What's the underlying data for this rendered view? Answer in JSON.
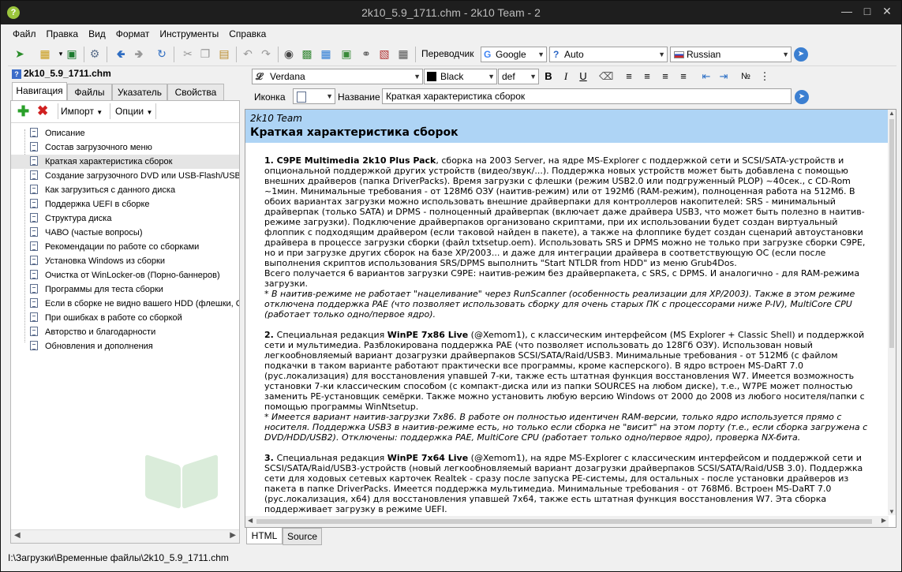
{
  "window": {
    "title": "2k10_5.9_1711.chm - 2k10 Team - 2",
    "app_icon": "?"
  },
  "menu": [
    "Файл",
    "Правка",
    "Вид",
    "Формат",
    "Инструменты",
    "Справка"
  ],
  "toolbar": {
    "translator_label": "Переводчик",
    "engine": "Google",
    "source_lang": "Auto",
    "target_lang": "Russian"
  },
  "left_panel": {
    "file_name": "2k10_5.9_1711.chm",
    "tabs": [
      "Навигация",
      "Файлы",
      "Указатель",
      "Свойства"
    ],
    "import_label": "Импорт",
    "options_label": "Опции",
    "tree": [
      "Описание",
      "Состав загрузочного меню",
      "Краткая характеристика сборок",
      "Создание загрузочного DVD или USB-Flash/USB+",
      "Как загрузиться с данного диска",
      "Поддержка UEFI в сборке",
      "Структура диска",
      "ЧАВО (частые вопросы)",
      "Рекомендации по работе со сборками",
      "Установка Windows из сборки",
      "Очистка от WinLocker-ов (Порно-баннеров)",
      "Программы для теста сборки",
      "Если в сборке не видно вашего HDD (флешки, CI",
      "При ошибках в работе со сборкой",
      "Авторство и благодарности",
      "Обновления и дополнения"
    ],
    "selected_index": 2
  },
  "status_path": "I:\\Загрузки\\Временные файлы\\2k10_5.9_1711.chm",
  "editor": {
    "font": "Verdana",
    "color": "Black",
    "size": "def",
    "icon_label": "Иконка",
    "name_label": "Название",
    "name_value": "Краткая характеристика сборок"
  },
  "document": {
    "team": "2k10 Team",
    "heading": "Краткая характеристика сборок",
    "p1_num": "1. ",
    "p1_title": "C9PE Multimedia 2k10 Plus Pack",
    "p1_text": ", сборка на 2003 Server, на ядре MS-Explorer с поддержкой сети и SCSI/SATA-устройств и опциональной поддержкой других устройств (видео/звук/...). Поддержка новых устройств может быть добавлена с помощью внешних драйверов (папка DriverPacks). Время загрузки с флешки (режим USB2.0 или подгруженный PLOP) ~40сек., с CD-Rom ~1мин. Минимальные требования - от 128Мб ОЗУ (наитив-режим) или от 192Мб (RAM-режим), полноценная работа на 512Мб. В обоих вариантах загрузки можно использовать внешние драйверпаки для контроллеров накопителей: SRS - минимальный драйверпак (только SATA) и DPMS - полноценный драйверпак (включает даже драйвера USB3, что может быть полезно в наитив-режиме загрузки). Подключение драйверпаков организовано скриптами, при их использовании будет создан виртуальный флоппик с подходящим драйвером (если таковой найден в пакете), а также на флоппике будет создан сценарий автоустановки драйвера в процессе загрузки сборки (файл txtsetup.oem). Использовать SRS и DPMS можно не только при загрузке сборки C9PE, но и при загрузке других сборок на базе XP/2003... и даже для интеграции драйвера в соответствующую ОС (если после выполнения скриптов использования SRS/DPMS выполнить \"Start NTLDR from HDD\" из меню Grub4Dos.",
    "p1_text2": "Всего получается 6 вариантов загрузки C9PE: наитив-режим без драйверпакета, с SRS, с DPMS. И аналогично - для RAM-режима загрузки.",
    "p1_note": "* В наитив-режиме не работает \"нацеливание\" через RunScanner (особенность реализации для XP/2003). Также в этом режиме отключена поддержка PAE (что позволяет использовать сборку для очень старых ПК с процессорами ниже P-IV), MultiCore CPU (работает только одно/первое ядро).",
    "p2_num": "2. ",
    "p2_pre": "Специальная редакция ",
    "p2_title": "WinPE 7x86 Live",
    "p2_text": " (@Xemom1), с классическим интерфейсом (MS Explorer + Classic Shell) и поддержкой сети и мультимедиа. Разблокирована поддержка PAE (что позволяет использовать до 128Гб ОЗУ). Использован новый легкообновляемый вариант дозагрузки драйверпаков SCSI/SATA/Raid/USB3. Минимальные требования - от 512Мб (с файлом подкачки в таком варианте работают практически все программы, кроме касперского). В ядро встроен MS-DaRT 7.0 (рус.локализация) для восстановления упавшей 7-ки, также есть штатная функция восстановления W7. Имеется возможность установки 7-ки классическим способом (с компакт-диска или из папки SOURCES на любом диске), т.е., W7PE может полностью заменить PE-установщик семёрки. Также можно установить любую версию Windows от 2000 до 2008 из любого носителя/папки с помощью программы WinNtsetup.",
    "p2_note": "* Имеется вариант наитив-загрузки 7x86. В работе он полностью идентичен RAM-версии, только ядро используется прямо с носителя. Поддержка USB3 в наитив-режиме есть, но только если сборка не \"висит\" на этом порту (т.е., если сборка загружена с DVD/HDD/USB2). Отключены: поддержка PAE, MultiCore CPU (работает только одно/первое ядро), проверка NX-бита.",
    "p3_num": "3. ",
    "p3_pre": "Специальная редакция ",
    "p3_title": "WinPE 7x64 Live",
    "p3_text": " (@Xemom1), на ядре MS-Explorer с классическим интерфейсом и поддержкой сети и SCSI/SATA/Raid/USB3-устройств (новый легкообновляемый вариант дозагрузки драйверпаков SCSI/SATA/Raid/USB 3.0). Поддержка сети для ходовых сетевых карточек Realtek - сразу после запуска PE-системы, для остальных - после установки драйверов из пакета в папке DriverPacks. Имеется поддержка мультимедиа. Минимальные требования - от 768Мб. Встроен MS-DaRT 7.0 (рус.локализация, x64) для восстановления упавшей 7x64, также есть штатная функция восстановления W7. Эта сборка поддерживает загрузку в режиме UEFI."
  },
  "bottom_tabs": [
    "HTML",
    "Source"
  ]
}
